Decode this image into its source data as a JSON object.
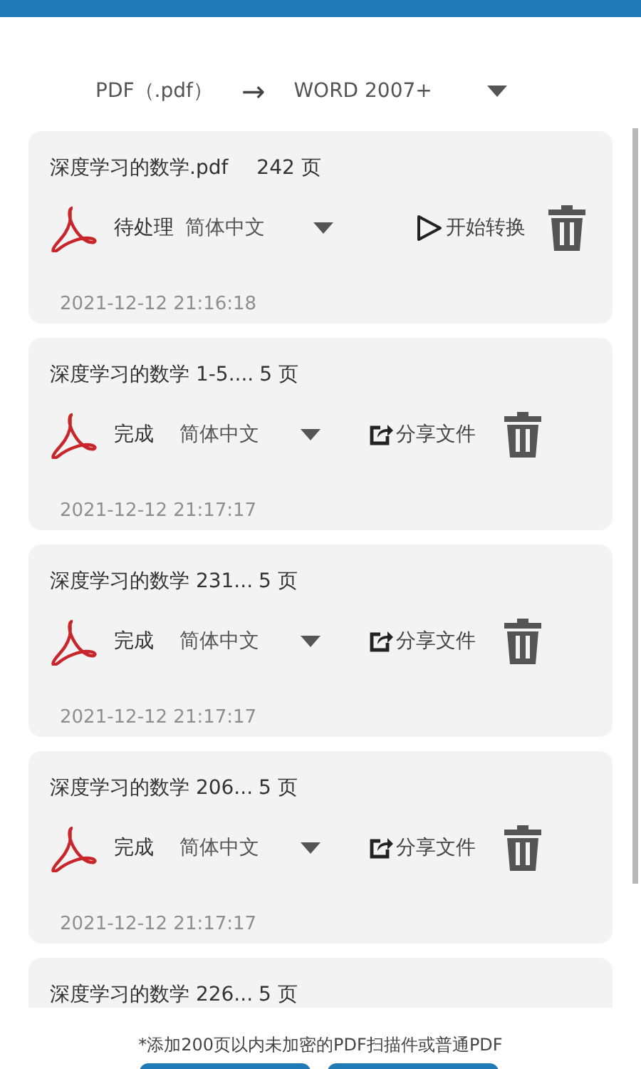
{
  "format": {
    "source": "PDF（.pdf）",
    "arrow": "→",
    "target": "WORD 2007+"
  },
  "files": [
    {
      "title": "深度学习的数学.pdf",
      "pages": "242 页",
      "status": "待处理",
      "language": "简体中文",
      "action": {
        "kind": "start",
        "label": "开始转换"
      },
      "time": "2021-12-12 21:16:18"
    },
    {
      "title": "深度学习的数学 1-5....",
      "pages": "5 页",
      "status": "完成",
      "language": "简体中文",
      "action": {
        "kind": "share",
        "label": "分享文件"
      },
      "time": "2021-12-12 21:17:17"
    },
    {
      "title": "深度学习的数学 231...",
      "pages": "5 页",
      "status": "完成",
      "language": "简体中文",
      "action": {
        "kind": "share",
        "label": "分享文件"
      },
      "time": "2021-12-12 21:17:17"
    },
    {
      "title": "深度学习的数学 206...",
      "pages": "5 页",
      "status": "完成",
      "language": "简体中文",
      "action": {
        "kind": "share",
        "label": "分享文件"
      },
      "time": "2021-12-12 21:17:17"
    },
    {
      "title": "深度学习的数学 226...",
      "pages": "5 页"
    }
  ],
  "note": "*添加200页以内未加密的PDF扫描件或普通PDF"
}
